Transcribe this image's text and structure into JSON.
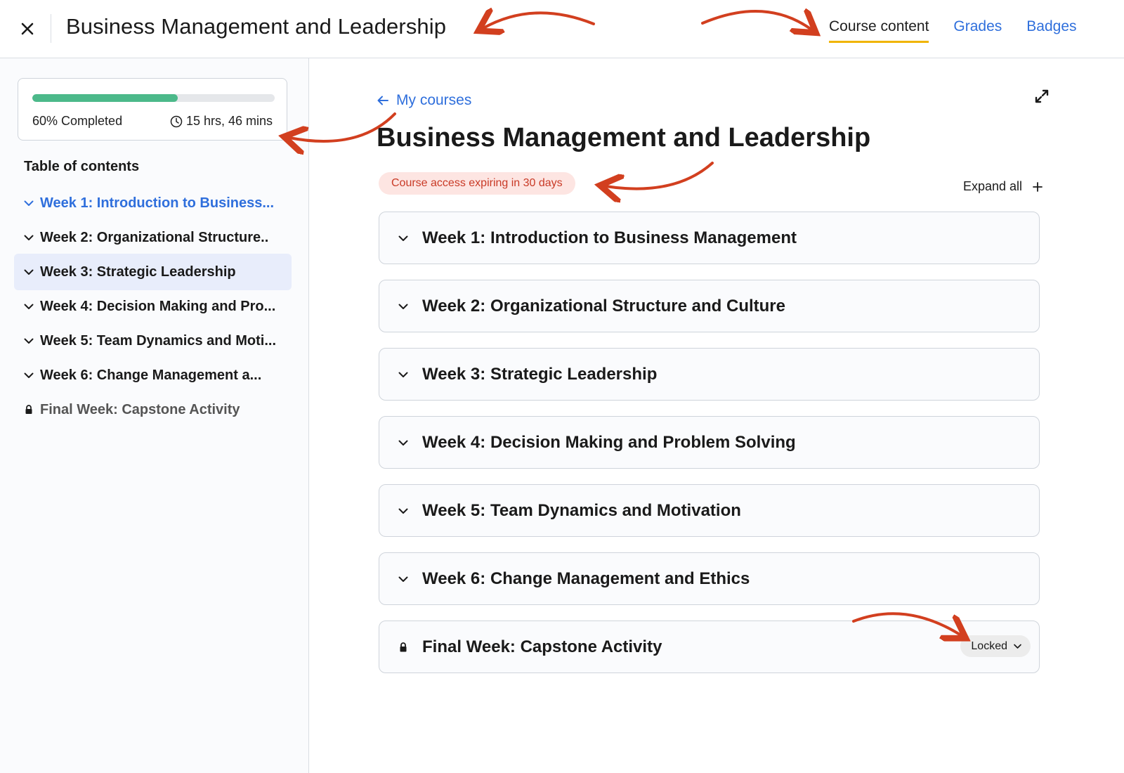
{
  "header": {
    "title": "Business Management and Leadership",
    "tabs": [
      {
        "label": "Course content",
        "active": true
      },
      {
        "label": "Grades",
        "active": false
      },
      {
        "label": "Badges",
        "active": false
      }
    ]
  },
  "sidebar": {
    "progress": {
      "percent": 60,
      "completed_label": "60% Completed",
      "time_label": "15 hrs, 46 mins"
    },
    "toc_heading": "Table of contents",
    "items": [
      {
        "label": "Week 1: Introduction to Business...",
        "state": "current"
      },
      {
        "label": "Week 2: Organizational Structure..",
        "state": "normal"
      },
      {
        "label": "Week 3: Strategic Leadership",
        "state": "selected"
      },
      {
        "label": "Week 4: Decision Making and Pro...",
        "state": "normal"
      },
      {
        "label": "Week 5: Team Dynamics and Moti...",
        "state": "normal"
      },
      {
        "label": "Week 6: Change Management a...",
        "state": "normal"
      },
      {
        "label": "Final Week: Capstone Activity",
        "state": "locked"
      }
    ]
  },
  "main": {
    "back_link": "My courses",
    "title": "Business Management and Leadership",
    "expiry_badge": "Course access expiring in 30 days",
    "expand_all": "Expand all",
    "weeks": [
      {
        "title": "Week 1: Introduction to Business Management",
        "locked": false
      },
      {
        "title": "Week 2: Organizational Structure and Culture",
        "locked": false
      },
      {
        "title": "Week 3: Strategic Leadership",
        "locked": false
      },
      {
        "title": "Week 4: Decision Making and Problem Solving",
        "locked": false
      },
      {
        "title": "Week 5: Team Dynamics and Motivation",
        "locked": false
      },
      {
        "title": "Week 6: Change Management and Ethics",
        "locked": false
      },
      {
        "title": "Final Week: Capstone Activity",
        "locked": true
      }
    ],
    "locked_label": "Locked"
  },
  "colors": {
    "accent": "#2f6fdc",
    "progress": "#4cb98a",
    "tab_underline": "#f0b400",
    "badge_bg": "#fde5e2",
    "badge_text": "#c93a26",
    "annotation": "#d23f1f"
  }
}
